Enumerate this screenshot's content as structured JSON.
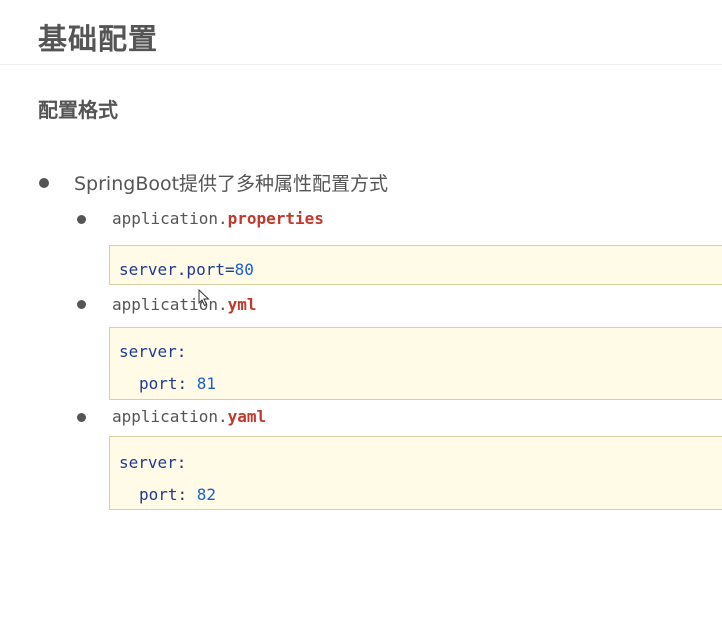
{
  "title": "基础配置",
  "subtitle": "配置格式",
  "bullet_main": "SpringBoot提供了多种属性配置方式",
  "items": [
    {
      "prefix": "application.",
      "ext": "properties",
      "code": [
        {
          "key": "server.port=",
          "value": "80"
        }
      ]
    },
    {
      "prefix": "application.",
      "ext": "yml",
      "code": [
        {
          "key": "server:",
          "value": ""
        },
        {
          "key": "port: ",
          "value": "81"
        }
      ]
    },
    {
      "prefix": "application.",
      "ext": "yaml",
      "code": [
        {
          "key": "server:",
          "value": ""
        },
        {
          "key": "port: ",
          "value": "82"
        }
      ]
    }
  ]
}
